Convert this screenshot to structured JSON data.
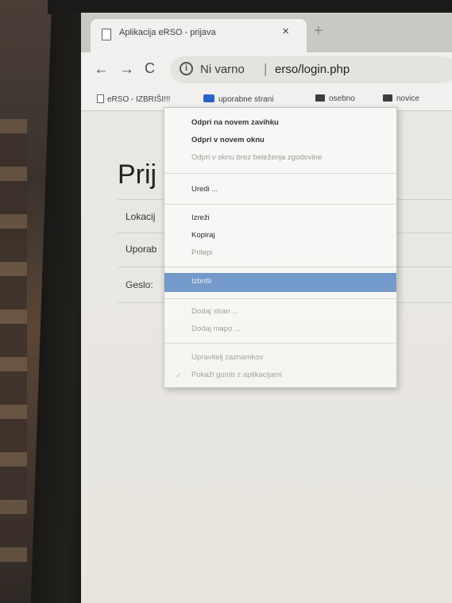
{
  "browser": {
    "tab": {
      "title": "Aplikacija eRSO - prijava",
      "close_glyph": "×"
    },
    "new_tab_glyph": "+",
    "nav": {
      "back": "←",
      "forward": "→",
      "reload": "C"
    },
    "omnibox": {
      "info_glyph": "i",
      "security_label": "Ni varno",
      "separator": "|",
      "url": "erso/login.php"
    },
    "bookmarks": [
      {
        "label": "eRSO - IZBRIŠI!!!",
        "icon": "page-icon"
      },
      {
        "label": "uporabne strani",
        "icon": "folder-blue-icon"
      },
      {
        "label": "osebno",
        "icon": "folder-icon"
      },
      {
        "label": "novice",
        "icon": "folder-icon"
      }
    ]
  },
  "page": {
    "heading": "Prij",
    "fields": [
      {
        "label": "Lokacij"
      },
      {
        "label": "Uporab"
      },
      {
        "label": "Geslo:"
      }
    ]
  },
  "context_menu": {
    "items": [
      {
        "label": "Odpri na novem zavihku",
        "state": "bold"
      },
      {
        "label": "Odpri v novem oknu",
        "state": "bold"
      },
      {
        "label": "Odpri v oknu brez beleženja zgodovine",
        "state": "disabled"
      },
      {
        "label": "Uredi ...",
        "state": "normal"
      },
      {
        "label": "Izreži",
        "state": "normal"
      },
      {
        "label": "Kopiraj",
        "state": "normal"
      },
      {
        "label": "Prilepi",
        "state": "disabled"
      },
      {
        "label": "Izbriši",
        "state": "highlighted"
      },
      {
        "label": "Dodaj stran ...",
        "state": "disabled"
      },
      {
        "label": "Dodaj mapo ...",
        "state": "disabled"
      },
      {
        "label": "Upravitelj zaznamkov",
        "state": "disabled"
      },
      {
        "label": "Pokaži gumb z aplikacijami",
        "state": "disabled",
        "checked": true
      }
    ],
    "check_glyph": "✓"
  },
  "colors": {
    "highlight": "#6f97c9",
    "bookmark_blue": "#2a64c8"
  }
}
